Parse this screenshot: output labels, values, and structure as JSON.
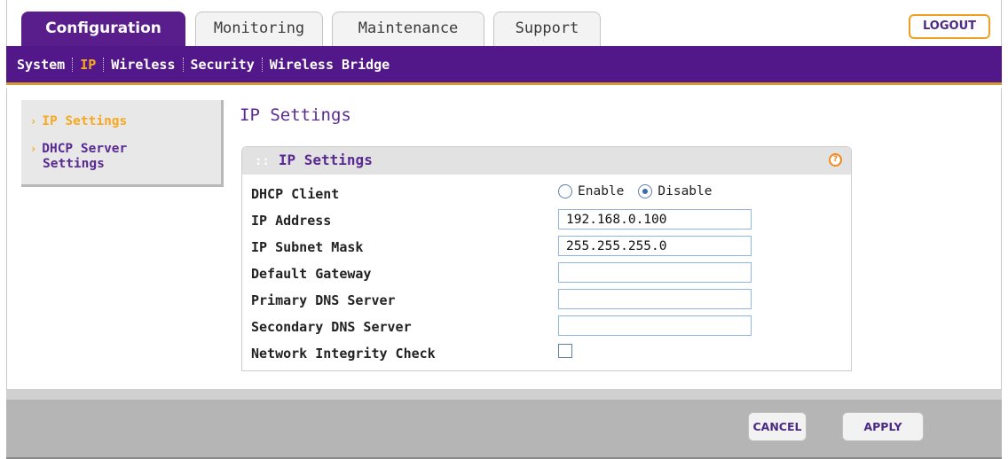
{
  "tabs": [
    {
      "label": "Configuration",
      "active": true
    },
    {
      "label": "Monitoring",
      "active": false
    },
    {
      "label": "Maintenance",
      "active": false
    },
    {
      "label": "Support",
      "active": false
    }
  ],
  "logout_label": "LOGOUT",
  "subnav": [
    {
      "label": "System",
      "active": false
    },
    {
      "label": "IP",
      "active": true
    },
    {
      "label": "Wireless",
      "active": false
    },
    {
      "label": "Security",
      "active": false
    },
    {
      "label": "Wireless Bridge",
      "active": false
    }
  ],
  "sidebar": [
    {
      "label": "IP Settings",
      "active": true
    },
    {
      "label": "DHCP Server Settings",
      "active": false
    }
  ],
  "page_title": "IP Settings",
  "panel": {
    "title": "IP Settings",
    "help_icon": "help-icon"
  },
  "form": {
    "dhcp_client": {
      "label": "DHCP Client",
      "options": [
        "Enable",
        "Disable"
      ],
      "selected": "Disable"
    },
    "ip_address": {
      "label": "IP Address",
      "value": "192.168.0.100"
    },
    "subnet_mask": {
      "label": "IP Subnet Mask",
      "value": "255.255.255.0"
    },
    "gateway": {
      "label": "Default Gateway",
      "value": ""
    },
    "primary_dns": {
      "label": "Primary DNS Server",
      "value": ""
    },
    "secondary_dns": {
      "label": "Secondary DNS Server",
      "value": ""
    },
    "integrity_check": {
      "label": "Network Integrity Check",
      "checked": false
    }
  },
  "buttons": {
    "cancel": "CANCEL",
    "apply": "APPLY"
  },
  "colors": {
    "brand_purple": "#52188a",
    "accent_orange": "#f7a91f"
  }
}
